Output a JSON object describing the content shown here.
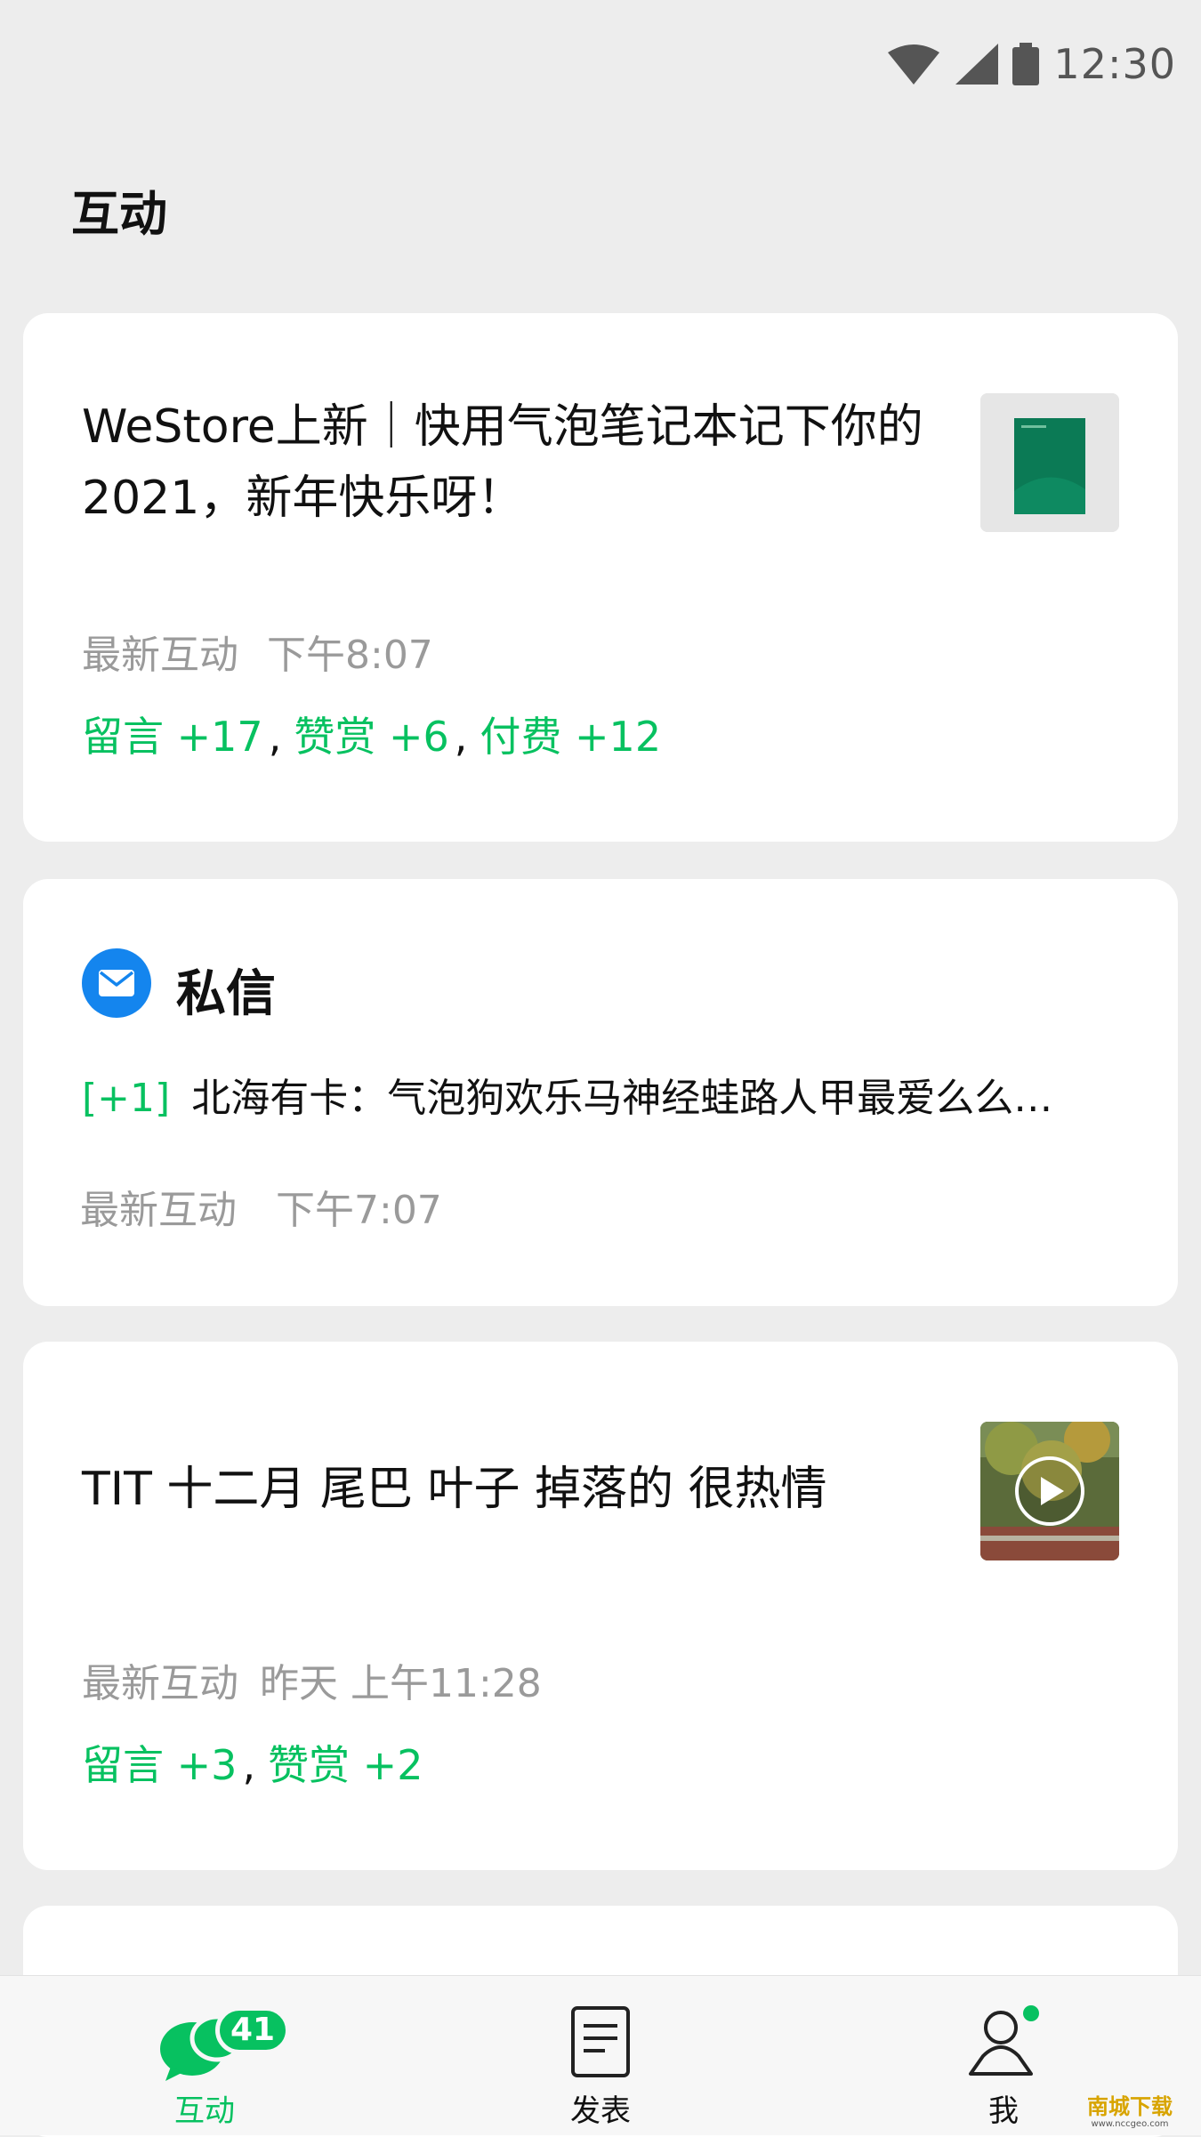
{
  "status_bar": {
    "time": "12:30"
  },
  "page": {
    "title": "互动"
  },
  "cards": [
    {
      "title": "WeStore上新｜快用气泡笔记本记下你的2021，新年快乐呀！",
      "latest_label": "最新互动",
      "latest_time": "下午8:07",
      "stats": [
        "留言 +17",
        "赞赏 +6",
        "付费 +12"
      ],
      "thumb_icon": "notebook-image"
    },
    {
      "title": "TIT 十二月 尾巴 叶子 掉落的 很热情",
      "latest_label": "最新互动",
      "latest_time": "昨天 上午11:28",
      "stats": [
        "留言 +3",
        "赞赏 +2"
      ],
      "thumb_icon": "video-thumbnail"
    }
  ],
  "private_message": {
    "title": "私信",
    "count": "[+1]",
    "preview": "北海有卡：气泡狗欢乐马神经蛙路人甲最爱么么…",
    "latest_label": "最新互动",
    "latest_time": "下午7:07",
    "icon": "mail-icon"
  },
  "tab_bar": {
    "tabs": [
      {
        "label": "互动",
        "icon": "chat-bubbles-icon",
        "badge": "41",
        "active": true
      },
      {
        "label": "发表",
        "icon": "document-icon"
      },
      {
        "label": "我",
        "icon": "person-icon"
      }
    ]
  },
  "watermark": {
    "text": "南城下载",
    "sub": "www.nccgeo.com"
  },
  "colors": {
    "accent": "#07c160",
    "mail_blue": "#1485ee",
    "background": "#ededed",
    "meta_gray": "#9a9a9a"
  }
}
